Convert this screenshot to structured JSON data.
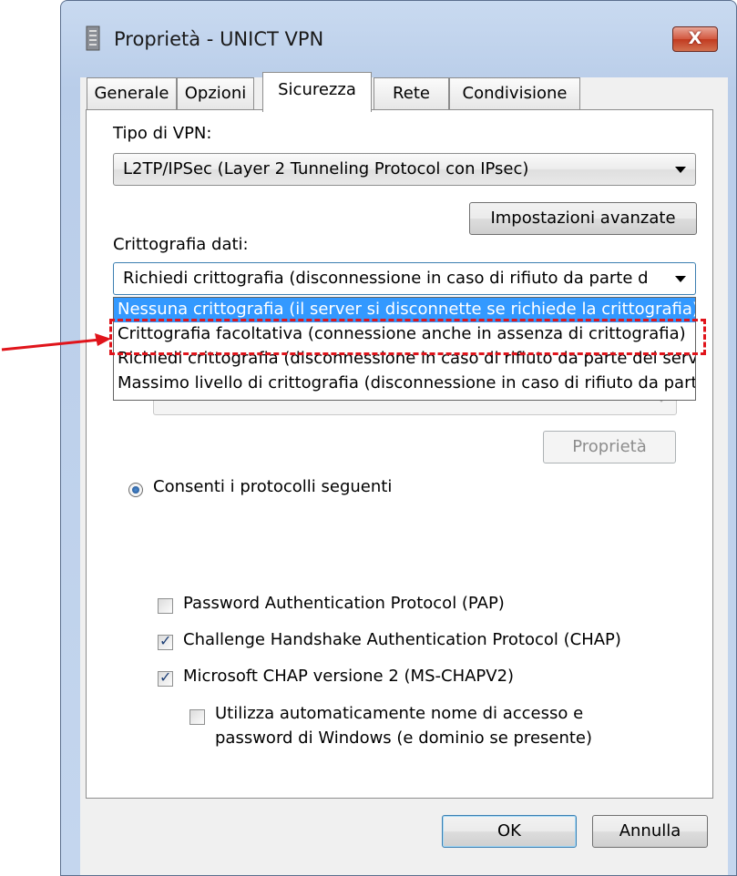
{
  "window": {
    "title": "Proprietà - UNICT VPN",
    "close_label": "X"
  },
  "tabs": [
    {
      "label": "Generale"
    },
    {
      "label": "Opzioni"
    },
    {
      "label": "Sicurezza"
    },
    {
      "label": "Rete"
    },
    {
      "label": "Condivisione"
    }
  ],
  "security": {
    "vpn_type_label": "Tipo di VPN:",
    "vpn_type_value": "L2TP/IPSec (Layer 2 Tunneling Protocol con IPsec)",
    "advanced_button": "Impostazioni avanzate",
    "encryption_label": "Crittografia dati:",
    "encryption_value": "Richiedi crittografia (disconnessione in caso di rifiuto da parte d",
    "encryption_options": [
      "Nessuna crittografia (il server si disconnette se richiede la crittografia)",
      "Crittografia facoltativa (connessione anche in assenza di crittografia)",
      "Richiedi crittografia (disconnessione in caso di rifiuto da parte del server)",
      "Massimo livello di crittografia (disconnessione in caso di rifiuto da parte del server)"
    ],
    "properties_button": "Proprietà",
    "allow_protocols_label": "Consenti i protocolli seguenti",
    "protocols": [
      {
        "label": "Password Authentication Protocol (PAP)",
        "checked": false
      },
      {
        "label": "Challenge Handshake Authentication Protocol (CHAP)",
        "checked": true
      },
      {
        "label": "Microsoft CHAP versione 2 (MS-CHAPV2)",
        "checked": true
      }
    ],
    "auto_logon_line1": "Utilizza automaticamente nome di accesso e",
    "auto_logon_line2": "password di Windows (e dominio se presente)",
    "auto_logon_checked": false
  },
  "footer": {
    "ok_label": "OK",
    "cancel_label": "Annulla"
  },
  "colors": {
    "selection": "#3399ff",
    "annotation": "#e0141b"
  }
}
